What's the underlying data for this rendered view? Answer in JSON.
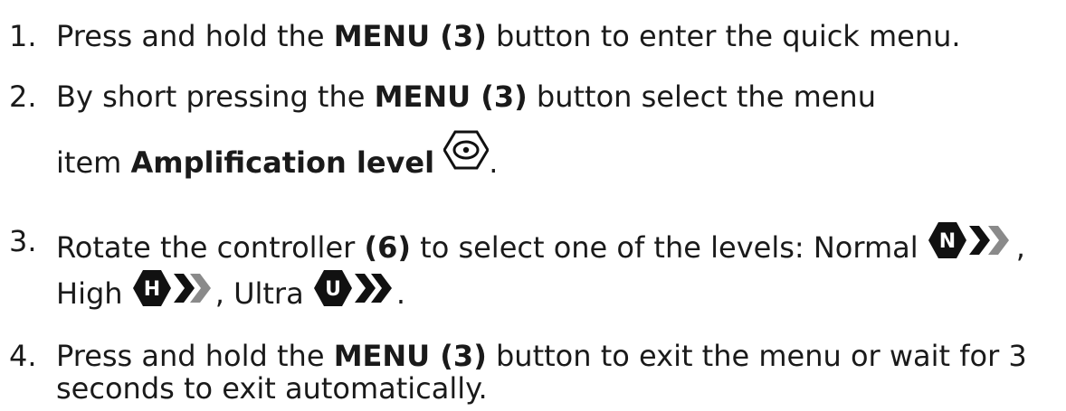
{
  "steps": [
    {
      "number": "1.",
      "prefix": "Press and hold the ",
      "bold": "MENU (3)",
      "suffix": " button to enter the quick menu."
    },
    {
      "number": "2.",
      "prefix": "By short pressing the ",
      "bold": "MENU (3)",
      "suffix": " button select the menu",
      "line2_prefix": "item ",
      "line2_bold": "Amplification level",
      "line2_icon": "amplification-level-icon",
      "line2_suffix": "."
    },
    {
      "number": "3.",
      "prefix": "Rotate the controller ",
      "bold": "(6)",
      "suffix": " to select one of the levels: Normal",
      "after_normal": ",",
      "line2_high": "High",
      "line2_sep": ", Ultra",
      "line2_end": ".",
      "levels": [
        {
          "label": "Normal",
          "letter": "N",
          "icon": "level-normal-icon",
          "active_chevrons": 1
        },
        {
          "label": "High",
          "letter": "H",
          "icon": "level-high-icon",
          "active_chevrons": 2
        },
        {
          "label": "Ultra",
          "letter": "U",
          "icon": "level-ultra-icon",
          "active_chevrons": 3
        }
      ]
    },
    {
      "number": "4.",
      "prefix": "Press and hold the ",
      "bold": "MENU (3)",
      "suffix": " button to exit the menu or wait for 3",
      "line2": "seconds to exit automatically."
    }
  ],
  "colors": {
    "text": "#1a1a1a",
    "icon_dark": "#111111",
    "icon_muted": "#8a8a8a"
  }
}
